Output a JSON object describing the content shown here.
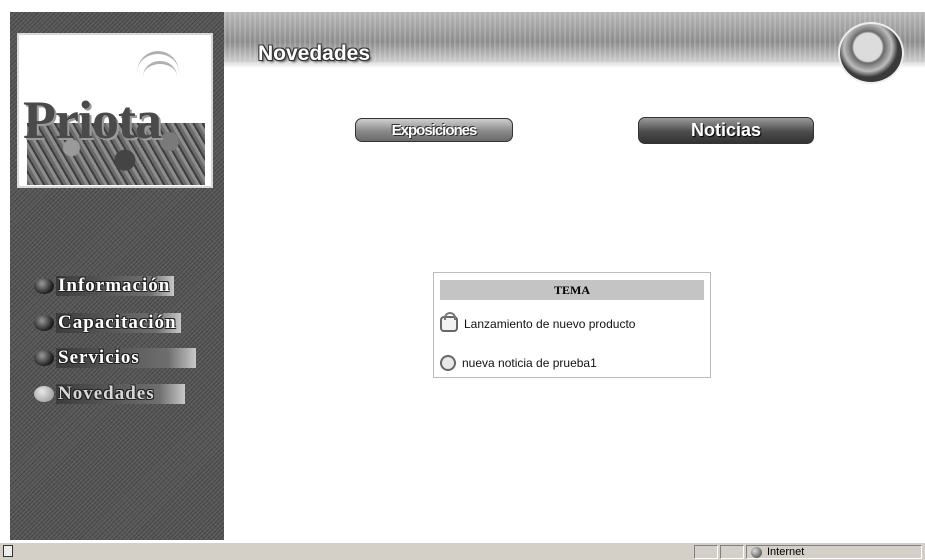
{
  "logo": {
    "text": "Priota"
  },
  "nav": [
    {
      "label": "Información",
      "state": "normal"
    },
    {
      "label": "Capacitación",
      "state": "normal"
    },
    {
      "label": "Servicios",
      "state": "normal"
    },
    {
      "label": "Novedades",
      "state": "active"
    }
  ],
  "header": {
    "title": "Novedades"
  },
  "tabs": {
    "exposiciones": "Exposiciones",
    "noticias": "Noticias"
  },
  "news": {
    "header": "TEMA",
    "items": [
      {
        "title": "Lanzamiento de nuevo producto",
        "icon": "folder-open-icon"
      },
      {
        "title": "nueva noticia de prueba1",
        "icon": "circle-icon"
      }
    ]
  },
  "statusbar": {
    "zone": "Internet"
  }
}
